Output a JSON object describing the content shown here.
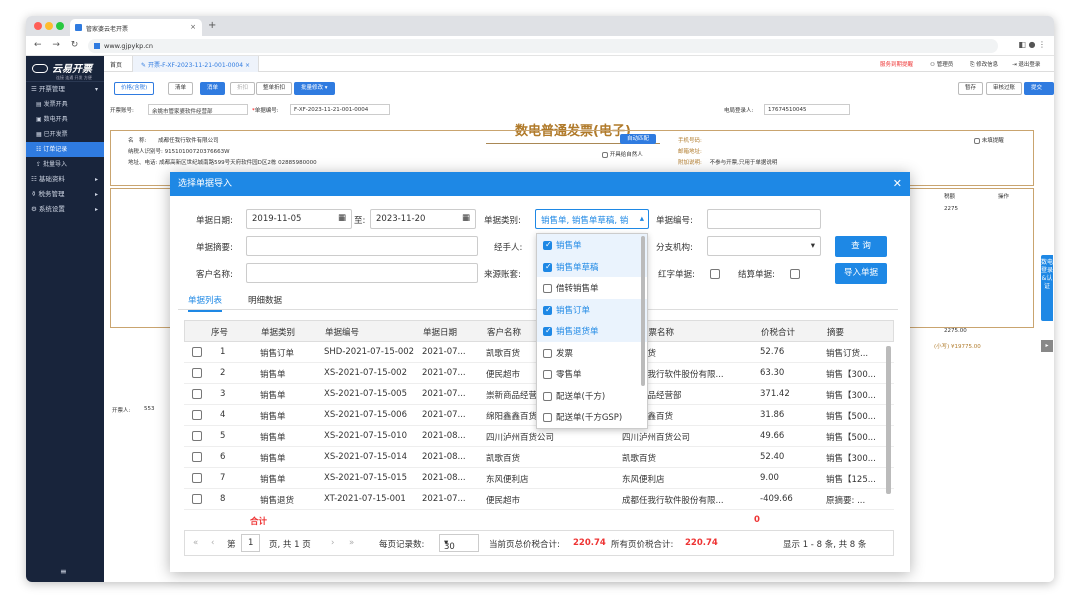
{
  "browser": {
    "tab_title": "管家婆云老开票",
    "url": "www.gjpykp.cn"
  },
  "sidebar": {
    "brand": "云易开票",
    "brand_sub": "连接 连通 开发 方便",
    "items": [
      {
        "label": "开票管理",
        "group": true,
        "arrow": "▾"
      },
      {
        "label": "发票开具"
      },
      {
        "label": "数电开具"
      },
      {
        "label": "已开发票"
      },
      {
        "label": "订单记录",
        "active": true
      },
      {
        "label": "批量导入"
      },
      {
        "label": "基础资料",
        "group": true,
        "arrow": "▸"
      },
      {
        "label": "税务管理",
        "group": true,
        "arrow": "▸"
      },
      {
        "label": "系统设置",
        "group": true,
        "arrow": "▸"
      }
    ],
    "bottom_icon": "≡"
  },
  "page_tabs": {
    "home": "首页",
    "current": "开票-F-XF-2023-11-21-001-0004",
    "right": [
      "服务到期提醒",
      "管理员",
      "修改信息",
      "退出登录"
    ]
  },
  "toolbar": {
    "buttons": [
      "价格(含税)",
      "清单",
      "消单",
      "折扣",
      "整单折扣",
      "批量修改 ▾"
    ],
    "right": [
      "暂存",
      "审核过账",
      "提交开票"
    ]
  },
  "form": {
    "org_label": "开票账号:",
    "org_value": "余姚市管家婆软件经营部",
    "bill_label": "单据编号:",
    "bill_value": "F-XF-2023-11-21-001-0004",
    "invoice_title": "数电普通发票(电子)",
    "login_label": "电局登录人:",
    "login_value": "17674510045",
    "buyer_name": "成都任我行软件有限公司",
    "buyer_tax": "91510100720376663W",
    "buyer_addr": "成都高新区世纪城南路599号天府软件园D区2栋 02885980000",
    "match_btn": "自动匹配",
    "natural": "开具给自然人",
    "phone_label": "手机号码:",
    "email_label": "邮箱地址:",
    "note_label": "附加说明:",
    "note_value": "不参与开票,只用于单据说明",
    "not_remind": "未填提醒",
    "col_tax": "税额",
    "col_op": "操作",
    "tax_value": "2275",
    "total_label": "合计",
    "total_tax": "2275.00",
    "total_inclusive": "(小写) ¥19775.00",
    "drawer": "开票人:",
    "drawer_value": "553"
  },
  "dialog": {
    "title": "选择单据导入",
    "close": "✕",
    "date_label": "单据日期:",
    "date_from": "2019-11-05",
    "date_to_label": "至:",
    "date_to": "2023-11-20",
    "type_label": "单据类别:",
    "type_value": "销售单, 销售单草稿, 销",
    "billno_label": "单据编号:",
    "summary_label": "单据摘要:",
    "handler_label": "经手人:",
    "branch_label": "分支机构:",
    "query_btn": "查 询",
    "customer_label": "客户名称:",
    "account_label": "来源账套:",
    "red_label": "红字单据:",
    "settle_label": "结算单据:",
    "import_btn": "导入单据",
    "tabs": [
      "单据列表",
      "明细数据"
    ],
    "columns": [
      "序号",
      "单据类别",
      "单据编号",
      "单据日期",
      "客户名称",
      "客户开票名称",
      "价税合计",
      "摘要"
    ],
    "rows": [
      [
        "1",
        "销售订单",
        "SHD-2021-07-15-002",
        "2021-07...",
        "凯歌百货",
        "凯歌百货",
        "52.76",
        "销售订货..."
      ],
      [
        "2",
        "销售单",
        "XS-2021-07-15-002",
        "2021-07...",
        "便民超市",
        "成都任我行软件股份有限...",
        "63.30",
        "销售【300..."
      ],
      [
        "3",
        "销售单",
        "XS-2021-07-15-005",
        "2021-07...",
        "崇新商品经营部",
        "崇新商品经营部",
        "371.42",
        "销售【300..."
      ],
      [
        "4",
        "销售单",
        "XS-2021-07-15-006",
        "2021-07...",
        "绵阳鑫鑫百货",
        "绵阳鑫鑫百货",
        "31.86",
        "销售【500..."
      ],
      [
        "5",
        "销售单",
        "XS-2021-07-15-010",
        "2021-08...",
        "四川泸州百货公司",
        "四川泸州百货公司",
        "49.66",
        "销售【500..."
      ],
      [
        "6",
        "销售单",
        "XS-2021-07-15-014",
        "2021-08...",
        "凯歌百货",
        "凯歌百货",
        "52.40",
        "销售【300..."
      ],
      [
        "7",
        "销售单",
        "XS-2021-07-15-015",
        "2021-08...",
        "东风便利店",
        "东风便利店",
        "9.00",
        "销售【125..."
      ],
      [
        "8",
        "销售退货",
        "XT-2021-07-15-001",
        "2021-07...",
        "便民超市",
        "成都任我行软件股份有限...",
        "-409.66",
        "原摘要: ..."
      ]
    ],
    "total_label": "合计",
    "total_value": "0",
    "pager": {
      "page_label": "第",
      "page": "1",
      "page_suffix": "页, 共 1 页",
      "per_page_label": "每页记录数:",
      "per_page": "30",
      "cur_total_label": "当前页总价税合计:",
      "cur_total": "220.74",
      "all_total_label": "所有页价税合计:",
      "all_total": "220.74",
      "display": "显示 1 - 8 条, 共 8 条"
    },
    "dropdown": [
      {
        "label": "销售单",
        "checked": true
      },
      {
        "label": "销售单草稿",
        "checked": true
      },
      {
        "label": "借转销售单",
        "checked": false
      },
      {
        "label": "销售订单",
        "checked": true
      },
      {
        "label": "销售退货单",
        "checked": true
      },
      {
        "label": "发票",
        "checked": false
      },
      {
        "label": "零售单",
        "checked": false
      },
      {
        "label": "配送单(千方)",
        "checked": false
      },
      {
        "label": "配送单(千方GSP)",
        "checked": false
      }
    ]
  },
  "right_float": {
    "label": "数电登录&认证",
    "toggle": "▸"
  }
}
